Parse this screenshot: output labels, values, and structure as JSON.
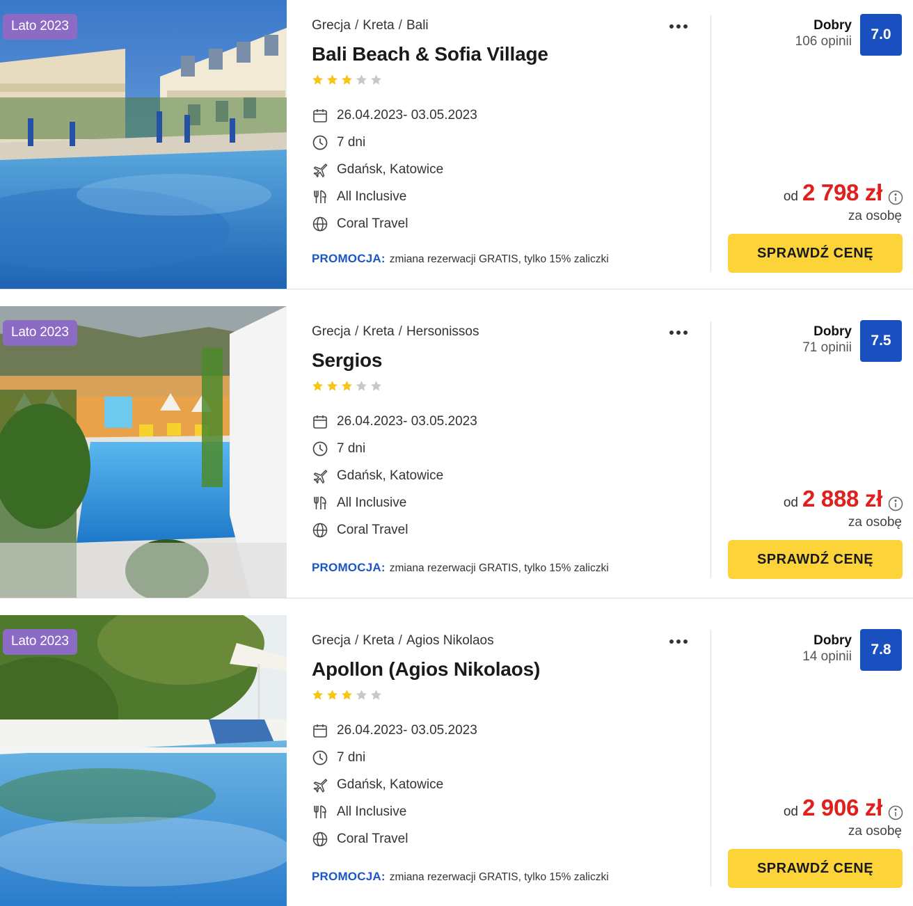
{
  "colors": {
    "badge": "#8c6bc4",
    "score": "#1a4fc0",
    "price": "#e0201c",
    "promo_label": "#1a56c8",
    "cta": "#fdd33a",
    "star_on": "#f5c518",
    "star_off": "#c8c8c8"
  },
  "cards": [
    {
      "badge": "Lato 2023",
      "favorite_icon": "heart-outline-icon",
      "crumbs": [
        "Grecja",
        "Kreta",
        "Bali"
      ],
      "title": "Bali Beach & Sofia Village",
      "stars": 3,
      "stars_max": 5,
      "dates": "26.04.2023- 03.05.2023",
      "duration": "7 dni",
      "departure": "Gdańsk, Katowice",
      "board": "All Inclusive",
      "operator": "Coral Travel",
      "promo_label": "PROMOCJA:",
      "promo_text": "zmiana rezerwacji GRATIS, tylko 15% zaliczki",
      "rating_word": "Dobry",
      "rating_count": "106 opinii",
      "score": "7.0",
      "price_prefix": "od",
      "price": "2 798 zł",
      "per_person": "za osobę",
      "cta": "SPRAWDŹ CENĘ"
    },
    {
      "badge": "Lato 2023",
      "favorite_icon": "heart-filled-icon",
      "crumbs": [
        "Grecja",
        "Kreta",
        "Hersonissos"
      ],
      "title": "Sergios",
      "stars": 3,
      "stars_max": 5,
      "dates": "26.04.2023- 03.05.2023",
      "duration": "7 dni",
      "departure": "Gdańsk, Katowice",
      "board": "All Inclusive",
      "operator": "Coral Travel",
      "promo_label": "PROMOCJA:",
      "promo_text": "zmiana rezerwacji GRATIS, tylko 15% zaliczki",
      "rating_word": "Dobry",
      "rating_count": "71 opinii",
      "score": "7.5",
      "price_prefix": "od",
      "price": "2 888 zł",
      "per_person": "za osobę",
      "cta": "SPRAWDŹ CENĘ"
    },
    {
      "badge": "Lato 2023",
      "favorite_icon": "heart-filled-icon",
      "crumbs": [
        "Grecja",
        "Kreta",
        "Agios Nikolaos"
      ],
      "title": "Apollon (Agios Nikolaos)",
      "stars": 3,
      "stars_max": 5,
      "dates": "26.04.2023- 03.05.2023",
      "duration": "7 dni",
      "departure": "Gdańsk, Katowice",
      "board": "All Inclusive",
      "operator": "Coral Travel",
      "promo_label": "PROMOCJA:",
      "promo_text": "zmiana rezerwacji GRATIS, tylko 15% zaliczki",
      "rating_word": "Dobry",
      "rating_count": "14 opinii",
      "score": "7.8",
      "price_prefix": "od",
      "price": "2 906 zł",
      "per_person": "za osobę",
      "cta": "SPRAWDŹ CENĘ"
    }
  ]
}
